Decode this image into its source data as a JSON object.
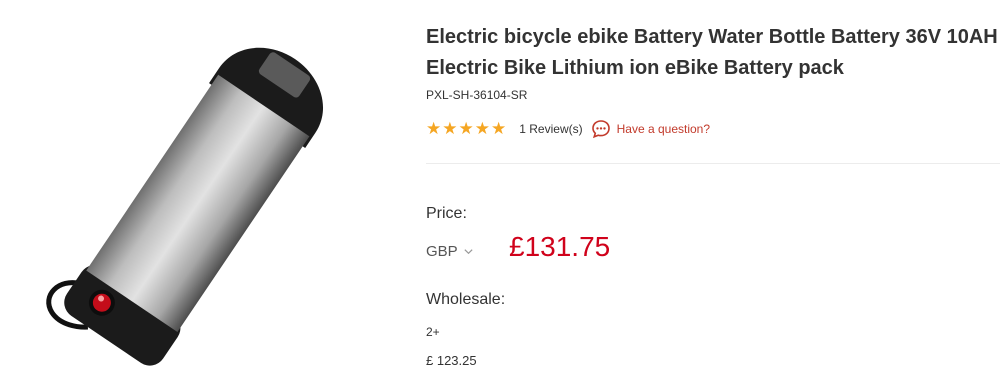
{
  "product": {
    "image_alt": "Water bottle style ebike battery",
    "title": "Electric bicycle ebike Battery Water Bottle Battery 36V 10AH Electric Bike Lithium ion eBike Battery pack",
    "sku": "PXL-SH-36104-SR",
    "rating": {
      "stars": 5,
      "reviews_label": "1 Review(s)"
    },
    "question_label": "Have a question?"
  },
  "pricing": {
    "price_label": "Price:",
    "currency": "GBP",
    "price": "£131.75",
    "wholesale_label": "Wholesale:",
    "tiers": [
      {
        "qty": "2+",
        "price": "£ 123.25"
      }
    ]
  },
  "colors": {
    "accent": "#d0021b",
    "question": "#c23a2b",
    "star": "#f5a623"
  },
  "icons": {
    "star": "star-icon",
    "question": "chat-question-icon",
    "currency_chevron": "chevron-down-icon"
  }
}
